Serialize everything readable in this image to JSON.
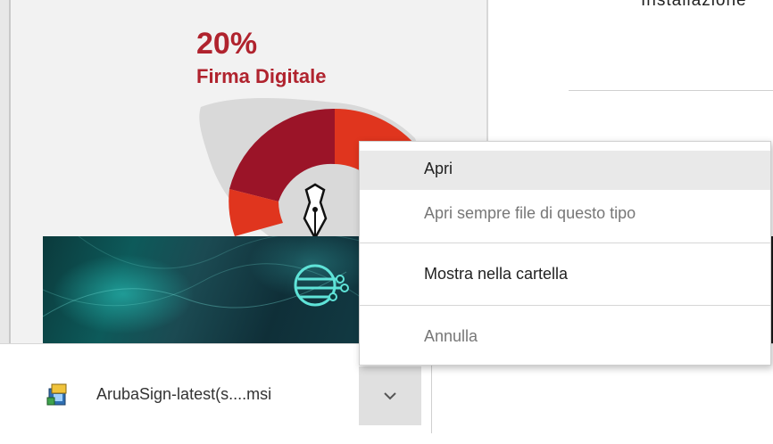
{
  "background": {
    "right_top_text": "Installazione"
  },
  "infographic": {
    "percent": "20%",
    "label": "Firma Digitale",
    "colors": {
      "dark_red": "#9b1428",
      "orange_red": "#e0351e",
      "text_red": "#b0232e"
    }
  },
  "context_menu": {
    "items": [
      {
        "label": "Apri",
        "enabled": true,
        "highlighted": true
      },
      {
        "label": "Apri sempre file di questo tipo",
        "enabled": false
      },
      {
        "label": "Mostra nella cartella",
        "enabled": true
      },
      {
        "label": "Annulla",
        "enabled": false
      }
    ]
  },
  "download_bar": {
    "file_name": "ArubaSign-latest(s....msi",
    "file_icon": "msi-installer-icon",
    "menu_button_icon": "chevron-down-icon"
  }
}
